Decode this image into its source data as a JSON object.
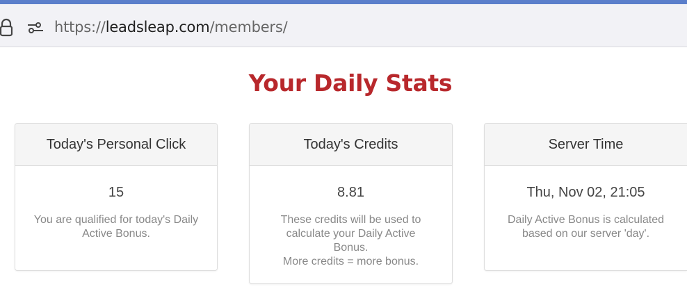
{
  "browser": {
    "url_scheme": "https://",
    "url_host": "leadsleap.com",
    "url_path": "/members/",
    "icons": [
      "lock-icon",
      "page-settings-icon"
    ]
  },
  "page": {
    "title": "Your Daily Stats",
    "title_color": "#b8282c"
  },
  "cards": [
    {
      "header": "Today's Personal Click",
      "value": "15",
      "note_lines": [
        "You are qualified for today's Daily",
        "Active Bonus."
      ]
    },
    {
      "header": "Today's Credits",
      "value": "8.81",
      "note_lines": [
        "These credits will be used to",
        "calculate your Daily Active",
        "Bonus.",
        "More credits = more bonus."
      ]
    },
    {
      "header": "Server Time",
      "value": "Thu, Nov 02, 21:05",
      "note_lines": [
        "Daily Active Bonus is calculated",
        "based on our server 'day'."
      ]
    }
  ]
}
